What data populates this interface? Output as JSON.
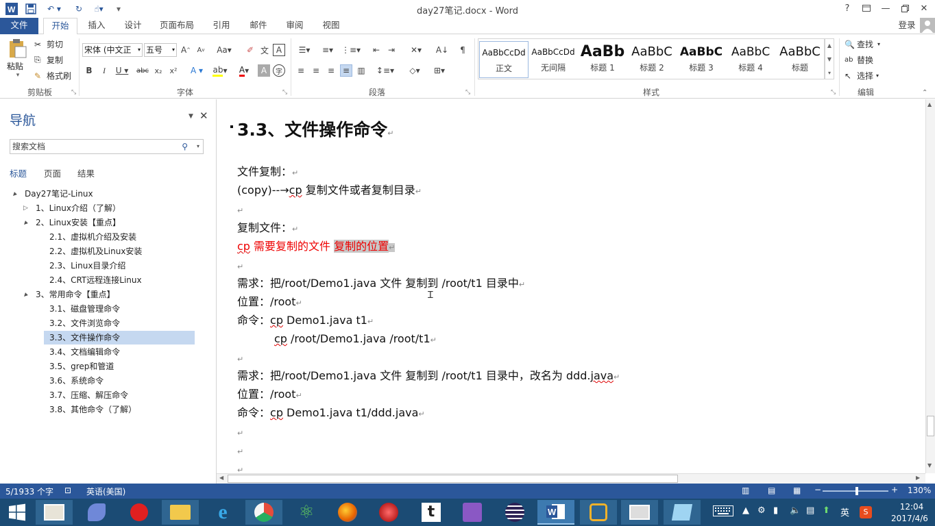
{
  "window": {
    "title": "day27笔记.docx - Word",
    "help": "?",
    "user": "登录"
  },
  "ribbon_tabs": [
    "文件",
    "开始",
    "插入",
    "设计",
    "页面布局",
    "引用",
    "邮件",
    "审阅",
    "视图"
  ],
  "clipboard": {
    "paste": "粘贴",
    "cut": "剪切",
    "copy": "复制",
    "format_painter": "格式刷",
    "label": "剪贴板"
  },
  "font": {
    "name": "宋体 (中文正",
    "size": "五号",
    "label": "字体"
  },
  "paragraph": {
    "label": "段落"
  },
  "styles": {
    "label": "样式",
    "items": [
      {
        "preview": "AaBbCcDd",
        "name": "正文"
      },
      {
        "preview": "AaBbCcDd",
        "name": "无间隔"
      },
      {
        "preview": "AaBb",
        "name": "标题 1"
      },
      {
        "preview": "AaBbC",
        "name": "标题 2"
      },
      {
        "preview": "AaBbC",
        "name": "标题 3"
      },
      {
        "preview": "AaBbC",
        "name": "标题 4"
      },
      {
        "preview": "AaBbC",
        "name": "标题"
      }
    ]
  },
  "editing": {
    "find": "查找",
    "replace": "替换",
    "select": "选择",
    "label": "编辑"
  },
  "nav": {
    "title": "导航",
    "search_placeholder": "搜索文档",
    "tabs": [
      "标题",
      "页面",
      "结果"
    ],
    "tree": [
      {
        "label": "Day27笔记-Linux",
        "level": 0,
        "toggle": "▲"
      },
      {
        "label": "1、Linux介绍（了解）",
        "level": 1,
        "toggle": "▷"
      },
      {
        "label": "2、Linux安装【重点】",
        "level": 1,
        "toggle": "▲"
      },
      {
        "label": "2.1、虚拟机介绍及安装",
        "level": 2,
        "toggle": ""
      },
      {
        "label": "2.2、虚拟机及Linux安装",
        "level": 2,
        "toggle": ""
      },
      {
        "label": "2.3、Linux目录介绍",
        "level": 2,
        "toggle": ""
      },
      {
        "label": "2.4、CRT远程连接Linux",
        "level": 2,
        "toggle": ""
      },
      {
        "label": "3、常用命令【重点】",
        "level": 1,
        "toggle": "▲"
      },
      {
        "label": "3.1、磁盘管理命令",
        "level": 2,
        "toggle": ""
      },
      {
        "label": "3.2、文件浏览命令",
        "level": 2,
        "toggle": ""
      },
      {
        "label": "3.3、文件操作命令",
        "level": 2,
        "toggle": "",
        "selected": true
      },
      {
        "label": "3.4、文档编辑命令",
        "level": 2,
        "toggle": ""
      },
      {
        "label": "3.5、grep和管道",
        "level": 2,
        "toggle": ""
      },
      {
        "label": "3.6、系统命令",
        "level": 2,
        "toggle": ""
      },
      {
        "label": "3.7、压缩、解压命令",
        "level": 2,
        "toggle": ""
      },
      {
        "label": "3.8、其他命令（了解）",
        "level": 2,
        "toggle": ""
      }
    ]
  },
  "document": {
    "heading": "3.3、文件操作命令",
    "l1": "文件复制：",
    "l2a": "(copy)--→",
    "l2b": "cp",
    "l2c": " 复制文件或者复制目录",
    "l3": "复制文件：",
    "l4a": "cp",
    "l4b": "  需要复制的文件  ",
    "l4c": "复制的位置",
    "r1": "需求：把/root/Demo1.java 文件  复制到    /root/t1  目录中",
    "r2": "位置：/root",
    "r3a": "命令：",
    "r3b": "cp",
    "r3c": " Demo1.java t1",
    "r4a": "cp",
    "r4b": " /root/Demo1.java /root/t1",
    "s1a": "需求：把/root/Demo1.java 文件  复制到    /root/t1  目录中，改名为 ddd.",
    "s1b": "java",
    "s2": "位置：/root",
    "s3a": "命令：",
    "s3b": "cp",
    "s3c": " Demo1.java t1/ddd.java",
    "para_mark": "↵"
  },
  "status": {
    "words": "5/1933 个字",
    "lang": "英语(美国)",
    "zoom": "130%"
  },
  "taskbar": {
    "time": "12:04",
    "date": "2017/4/6",
    "ime": "英"
  }
}
